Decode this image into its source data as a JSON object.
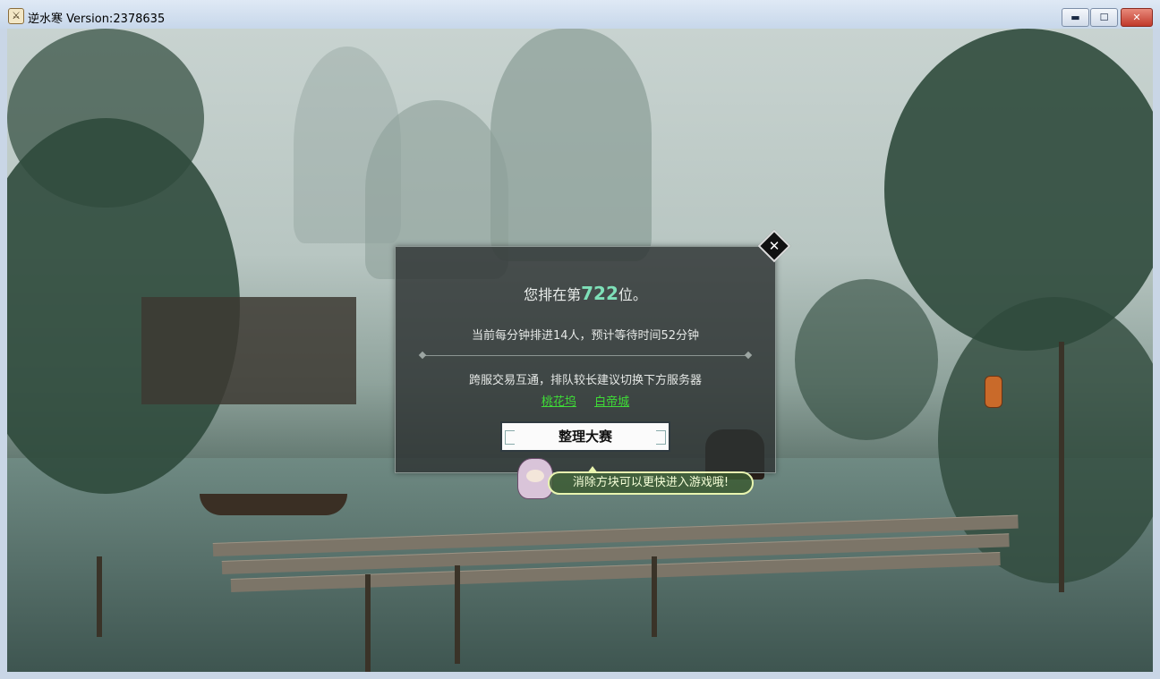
{
  "window": {
    "title": "逆水寒 Version:2378635",
    "app_icon": "app-logo-icon",
    "minimize_glyph": "▬",
    "maximize_glyph": "☐",
    "close_glyph": "✕"
  },
  "dialog": {
    "rank_prefix": "您排在第",
    "rank_number": "722",
    "rank_suffix": "位。",
    "rate_text": "当前每分钟排进14人，预计等待时间52分钟",
    "advice_text": "跨服交易互通，排队较长建议切换下方服务器",
    "servers": [
      "桃花坞",
      "白帝城"
    ],
    "game_button_label": "整理大赛",
    "close_glyph": "✕",
    "rank_color": "#7ee0b8",
    "server_link_color": "#3fdc37"
  },
  "tooltip": {
    "text": "消除方块可以更快进入游戏哦!"
  }
}
